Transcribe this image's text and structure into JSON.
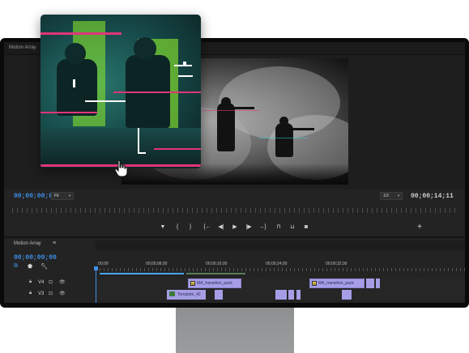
{
  "app": {
    "title": "Motion Array"
  },
  "program_monitor": {
    "current_timecode": "00;00;00;00",
    "zoom_fit": "Fit",
    "resolution": "1/2",
    "duration_timecode": "00;00;14;11"
  },
  "transport": {
    "buttons": [
      {
        "name": "add-marker",
        "glyph": "▼"
      },
      {
        "name": "mark-in",
        "glyph": "{"
      },
      {
        "name": "mark-out",
        "glyph": "}"
      },
      {
        "name": "go-to-in",
        "glyph": "{←"
      },
      {
        "name": "step-back",
        "glyph": "◀|"
      },
      {
        "name": "play",
        "glyph": "▶"
      },
      {
        "name": "step-forward",
        "glyph": "|▶"
      },
      {
        "name": "go-to-out",
        "glyph": "→}"
      },
      {
        "name": "lift",
        "glyph": "⊓"
      },
      {
        "name": "extract",
        "glyph": "⊔"
      },
      {
        "name": "export-frame",
        "glyph": "◙"
      },
      {
        "name": "add-button",
        "glyph": "+"
      }
    ]
  },
  "timeline": {
    "tab_label": "Motion Array",
    "menu_glyph": "≡",
    "timecode": "00;00;00;00",
    "ruler_labels": [
      ":00;00",
      "00;00;08;00",
      "00;00;16;00",
      "00;00;24;00",
      "00;00;32;00"
    ],
    "tracks": [
      {
        "id": "V4",
        "label": "V4"
      },
      {
        "id": "V3",
        "label": "V3"
      }
    ],
    "clips_v4": [
      {
        "label": "MA_transition_pack",
        "fx": "fx"
      },
      {
        "label": "MA_transition_pack",
        "fx": "fx"
      }
    ],
    "clips_v3": [
      {
        "label": "Template_42"
      }
    ]
  },
  "colors": {
    "accent_blue": "#3d8ee8",
    "clip_purple": "#a59ee6",
    "glitch_green": "#8fef2a",
    "glitch_magenta": "#e0357a"
  }
}
